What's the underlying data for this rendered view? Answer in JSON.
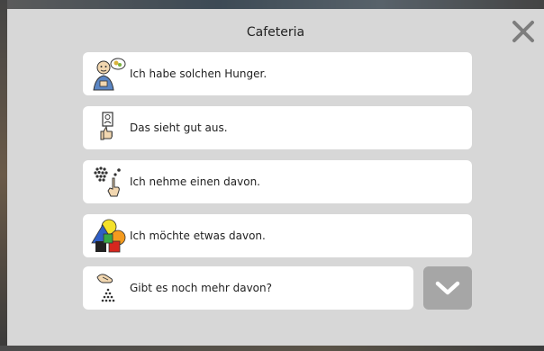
{
  "dialog": {
    "title": "Cafeteria",
    "close_icon": "close-icon"
  },
  "phrases": [
    {
      "label": "Ich habe solchen Hunger.",
      "icon": "hungry-person-icon"
    },
    {
      "label": "Das sieht gut aus.",
      "icon": "thumbs-up-photo-icon"
    },
    {
      "label": "Ich nehme einen davon.",
      "icon": "take-one-icon"
    },
    {
      "label": "Ich möchte etwas davon.",
      "icon": "shapes-icon"
    },
    {
      "label": "Gibt es noch mehr davon?",
      "icon": "more-of-it-icon"
    }
  ],
  "scroll": {
    "icon": "chevron-down-icon"
  },
  "colors": {
    "dialog_bg": "#d7d7d7",
    "button_bg": "#ffffff",
    "scroll_bg": "#a6a6a6"
  }
}
